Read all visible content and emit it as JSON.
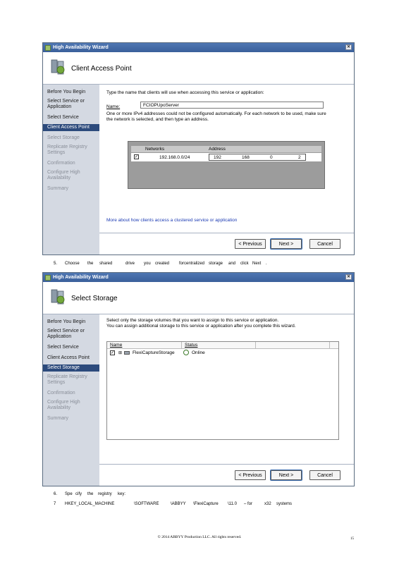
{
  "wizard1": {
    "title": "High Availability Wizard",
    "heading": "Client Access Point",
    "steps": [
      "Before You Begin",
      "Select Service or Application",
      "Select Service",
      "Client Access Point",
      "Select Storage",
      "Replicate Registry Settings",
      "Confirmation",
      "Configure High Availability",
      "Summary"
    ],
    "selected_step": "Client Access Point",
    "instruction": "Type the name that clients will use when accessing this service or application:",
    "name_label": "Name:",
    "name_value": "FCIOPUpoServer",
    "warning_line1": "One or more IPv4 addresses could not be configured automatically.  For each network to be used, make sure",
    "warning_line2": "the network is selected, and then type an address.",
    "table": {
      "col_networks": "Networks",
      "col_address": "Address",
      "row_network": "192.168.0.0/24",
      "row_address": [
        "192",
        "168",
        "0",
        "2"
      ]
    },
    "link": "More about how clients access a clustered service or application",
    "buttons": {
      "previous": "< Previous",
      "next": "Next >",
      "cancel": "Cancel"
    }
  },
  "step5": {
    "number": "5.",
    "words": [
      "Choose",
      "the",
      "shared",
      "drive",
      "you",
      "created",
      "forcentralized",
      "storage",
      "and",
      "click",
      "Next",
      "."
    ]
  },
  "wizard2": {
    "title": "High Availability Wizard",
    "heading": "Select Storage",
    "steps": [
      "Before You Begin",
      "Select Service or Application",
      "Select Service",
      "Client Access Point",
      "Select Storage",
      "Replicate Registry Settings",
      "Confirmation",
      "Configure High Availability",
      "Summary"
    ],
    "selected_step": "Select Storage",
    "instruction1": "Select only the storage volumes that you want to assign to this service or application.",
    "instruction2": "You can assign additional storage to this service or application after you complete this wizard.",
    "table": {
      "col_name": "Name",
      "col_status": "Status",
      "row_name": "FlexiCaptureStorage",
      "row_status": "Online"
    },
    "buttons": {
      "previous": "< Previous",
      "next": "Next >",
      "cancel": "Cancel"
    }
  },
  "step6": {
    "number": "6.",
    "words": [
      "Spe",
      "cify",
      "the",
      "registry",
      "key:"
    ]
  },
  "step7": {
    "number": "7",
    "words": [
      "HKEY_LOCAL_MACHINE",
      "\\SOFTWARE",
      "\\ABBYY",
      "\\FlexiCapture",
      "\\11.0",
      "– for",
      "x32",
      "systems"
    ]
  },
  "footer": {
    "copyright": "© 2014 ABBYY Production LLC. All rights reserved.",
    "page": "15"
  }
}
